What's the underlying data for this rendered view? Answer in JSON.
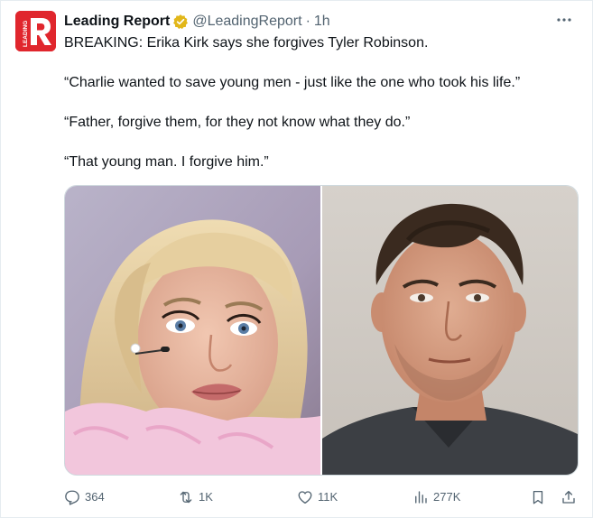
{
  "tweet": {
    "author_name": "Leading Report",
    "handle": "@LeadingReport",
    "separator": "·",
    "time": "1h",
    "avatar_text": "LEADING",
    "paragraphs": [
      "BREAKING: Erika Kirk says she forgives Tyler Robinson.",
      "“Charlie wanted to save young men - just like the one who took his life.”",
      "“Father, forgive them, for they not know what they do.”",
      "“That young man. I forgive him.”"
    ]
  },
  "actions": {
    "replies": "364",
    "reposts": "1K",
    "likes": "11K",
    "views": "277K"
  },
  "colors": {
    "brand_red": "#e0262d",
    "verified_gold": "#e2b719",
    "muted_text": "#536471"
  },
  "icons": {
    "more": "more-dots-icon",
    "verified": "verified-badge-icon",
    "reply": "reply-icon",
    "repost": "repost-icon",
    "like": "heart-icon",
    "views": "views-chart-icon",
    "bookmark": "bookmark-icon",
    "share": "share-icon"
  }
}
